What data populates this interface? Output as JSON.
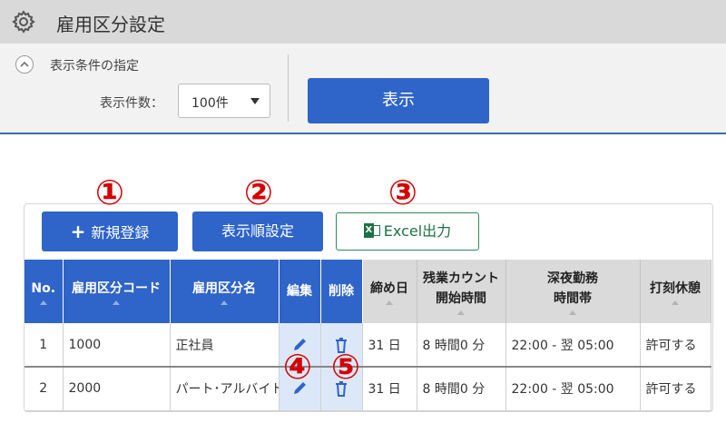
{
  "header": {
    "title": "雇用区分設定",
    "icon": "gear-icon"
  },
  "conditions": {
    "section_title": "表示条件の指定",
    "count_label": "表示件数：",
    "count_value": "100件",
    "show_button": "表示"
  },
  "toolbar": {
    "new_button": "新規登録",
    "order_button": "表示順設定",
    "excel_button": "Excel出力",
    "excel_icon_letter": "X"
  },
  "annotations": [
    "①",
    "②",
    "③",
    "④",
    "⑤"
  ],
  "table": {
    "headers": {
      "no": "No.",
      "code": "雇用区分コード",
      "name": "雇用区分名",
      "edit": "編集",
      "delete": "削除",
      "closing": "締め日",
      "overtime_1": "残業カウント",
      "overtime_2": "開始時間",
      "night_1": "深夜勤務",
      "night_2": "時間帯",
      "break": "打刻休憩"
    },
    "rows": [
      {
        "no": "1",
        "code": "1000",
        "name": "正社員",
        "closing": "31 日",
        "overtime": "8 時間0 分",
        "night": "22:00 - 翌 05:00",
        "break": "許可する"
      },
      {
        "no": "2",
        "code": "2000",
        "name": "パート･アルバイト",
        "closing": "31 日",
        "overtime": "8 時間0 分",
        "night": "22:00 - 翌 05:00",
        "break": "許可する"
      }
    ]
  },
  "colors": {
    "primary": "#2f64c8",
    "excel_green": "#1e7145",
    "annotation_red": "#d40000",
    "header_gray": "#d9d9d9"
  }
}
